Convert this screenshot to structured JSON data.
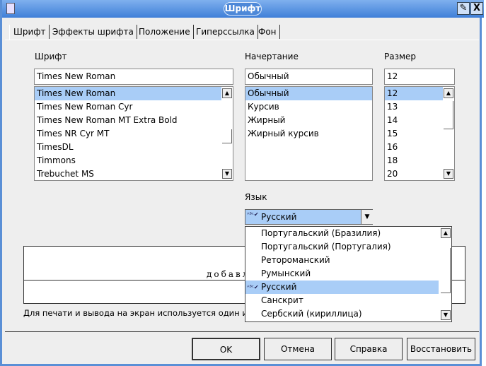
{
  "window": {
    "title": "Шрифт",
    "pin_icon": "pin-icon",
    "close_label": "X"
  },
  "tabs": [
    {
      "label": "Шрифт",
      "active": true
    },
    {
      "label": "Эффекты шрифта"
    },
    {
      "label": "Положение"
    },
    {
      "label": "Гиперссылка"
    },
    {
      "label": "Фон"
    }
  ],
  "font": {
    "label": "Шрифт",
    "value": "Times New Roman",
    "items": [
      "Times New Roman",
      "Times New Roman Cyr",
      "Times New Roman MT Extra Bold",
      "Times NR Cyr MT",
      "TimesDL",
      "Timmons",
      "Trebuchet MS"
    ],
    "selected": "Times New Roman"
  },
  "style": {
    "label": "Начертание",
    "value": "Обычный",
    "items": [
      "Обычный",
      "Курсив",
      "Жирный",
      "Жирный курсив"
    ],
    "selected": "Обычный"
  },
  "size": {
    "label": "Размер",
    "value": "12",
    "items": [
      "12",
      "13",
      "14",
      "15",
      "16",
      "18",
      "20"
    ],
    "selected": "12"
  },
  "language": {
    "label": "Язык",
    "value": "Русский",
    "items": [
      "Португальский (Бразилия)",
      "Португальский (Португалия)",
      "Ретороманский",
      "Румынский",
      "Русский",
      "Санскрит",
      "Сербский (кириллица)"
    ],
    "selected": "Русский",
    "spellcheck_icon": "abc-check-icon"
  },
  "preview": {
    "text": "добавл"
  },
  "footnote": "Для печати и вывода на экран используется один и",
  "buttons": {
    "ok": "OK",
    "cancel": "Отмена",
    "help": "Справка",
    "reset": "Восстановить"
  },
  "colors": {
    "title_bar": "#3f7fd8",
    "selection": "#a9cdf7",
    "dialog_bg": "#eeeeee"
  }
}
